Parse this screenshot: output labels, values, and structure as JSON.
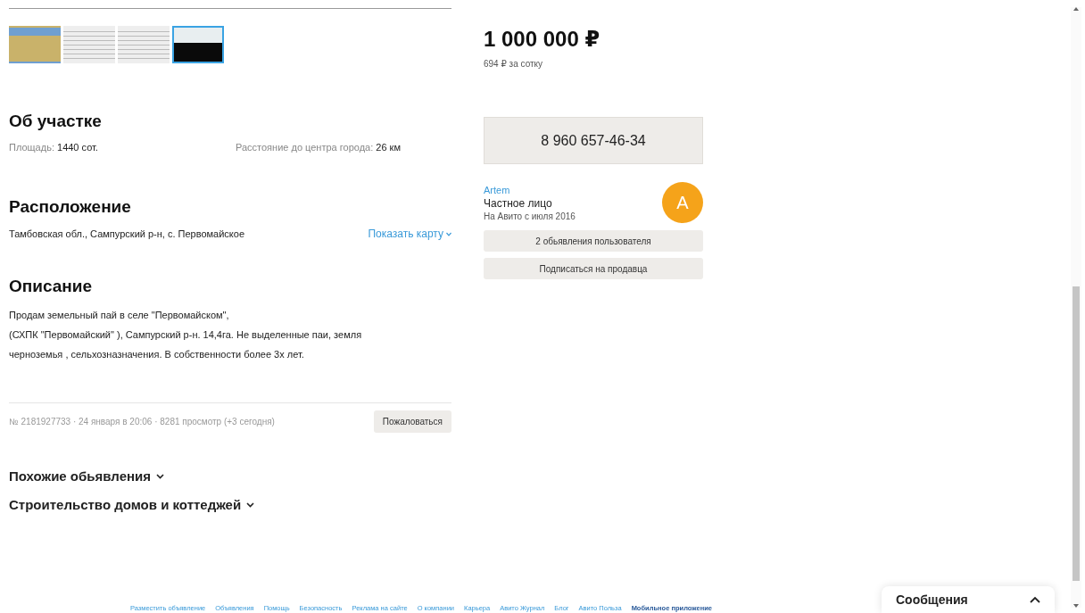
{
  "gallery": {
    "thumbnails": [
      {
        "kind": "field",
        "selected": false
      },
      {
        "kind": "document",
        "selected": false
      },
      {
        "kind": "document",
        "selected": false
      },
      {
        "kind": "dark",
        "selected": true
      }
    ]
  },
  "about": {
    "title": "Об участке",
    "params": [
      {
        "label": "Площадь:",
        "value": "1440 сот."
      },
      {
        "label": "Расстояние до центра города:",
        "value": "26 км"
      }
    ]
  },
  "location": {
    "title": "Расположение",
    "address": "Тамбовская обл., Сампурский р-н, с. Первомайское",
    "map_link": "Показать карту"
  },
  "description": {
    "title": "Описание",
    "paragraphs": [
      "Продам земельный пай в селе \"Первомайском\",",
      "(СХПК \"Первомайский\" ), Сампурский р-н. 14,4га. Не выделенные паи, земля черноземья , сельхозназначения. В собственности более 3х лет."
    ]
  },
  "meta": {
    "info": "№ 2181927733 · 24 января в 20:06 · 8281 просмотр (+3 сегодня)",
    "report_button": "Пожаловаться"
  },
  "sections": [
    {
      "title": "Похожие обьявления",
      "expanded": false
    },
    {
      "title": "Строительство домов и коттеджей",
      "expanded": false
    }
  ],
  "price": {
    "value": "1 000 000 ₽",
    "per_unit": "694 ₽ за сотку"
  },
  "phone_button": "8 960 657-46-34",
  "seller": {
    "name": "Artem",
    "type": "Частное лицо",
    "since": "На Авито с июля 2016",
    "avatar_letter": "A"
  },
  "seller_buttons": [
    "2 обьявления пользователя",
    "Подписаться на продавца"
  ],
  "footer_links": [
    {
      "label": "Разместить объявление",
      "bold": false
    },
    {
      "label": "Объявления",
      "bold": false
    },
    {
      "label": "Помощь",
      "bold": false
    },
    {
      "label": "Безопасность",
      "bold": false
    },
    {
      "label": "Реклама на сайте",
      "bold": false
    },
    {
      "label": "О компании",
      "bold": false
    },
    {
      "label": "Карьера",
      "bold": false
    },
    {
      "label": "Авито Журнал",
      "bold": false
    },
    {
      "label": "Блог",
      "bold": false
    },
    {
      "label": "Авито Польза",
      "bold": false
    },
    {
      "label": "Мобильное приложение",
      "bold": true
    }
  ],
  "messages": {
    "title": "Сообщения",
    "expanded": false
  }
}
